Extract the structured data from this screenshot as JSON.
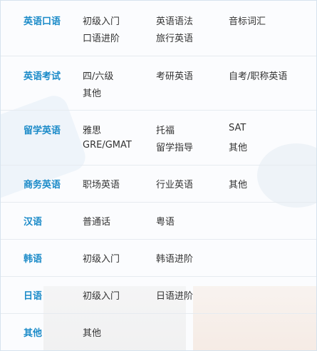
{
  "categories": [
    {
      "title": "英语口语",
      "items": [
        "初级入门",
        "英语语法",
        "音标词汇",
        "口语进阶",
        "旅行英语"
      ]
    },
    {
      "title": "英语考试",
      "items": [
        "四/六级",
        "考研英语",
        "自考/职称英语",
        "其他"
      ]
    },
    {
      "title": "留学英语",
      "items": [
        "雅思",
        "托福",
        "SAT",
        "GRE/GMAT",
        "留学指导",
        "其他"
      ]
    },
    {
      "title": "商务英语",
      "items": [
        "职场英语",
        "行业英语",
        "其他"
      ]
    },
    {
      "title": "汉语",
      "items": [
        "普通话",
        "粤语"
      ]
    },
    {
      "title": "韩语",
      "items": [
        "初级入门",
        "韩语进阶"
      ]
    },
    {
      "title": "日语",
      "items": [
        "初级入门",
        "日语进阶"
      ]
    },
    {
      "title": "其他",
      "items": [
        "其他"
      ]
    }
  ]
}
